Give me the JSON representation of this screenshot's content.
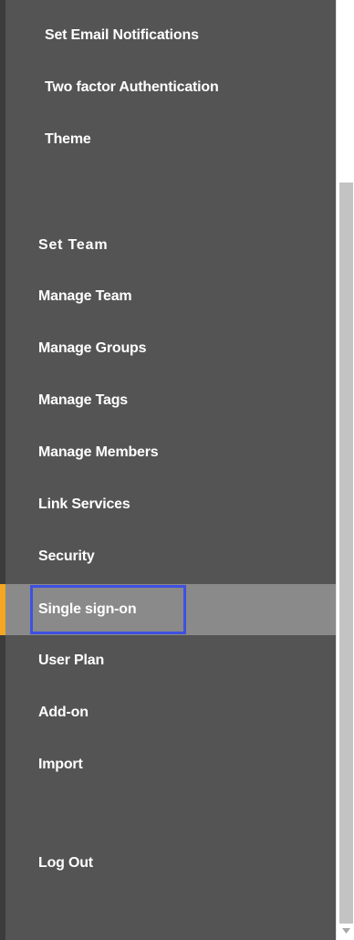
{
  "sidebar": {
    "items_top": [
      {
        "label": "Set Email Notifications"
      },
      {
        "label": "Two factor Authentication"
      },
      {
        "label": "Theme"
      }
    ],
    "section": {
      "label": "Set Team"
    },
    "items_team": [
      {
        "label": "Manage Team"
      },
      {
        "label": "Manage Groups"
      },
      {
        "label": "Manage Tags"
      },
      {
        "label": "Manage Members"
      },
      {
        "label": "Link Services"
      },
      {
        "label": "Security"
      },
      {
        "label": "Single sign-on"
      },
      {
        "label": "User Plan"
      },
      {
        "label": "Add-on"
      },
      {
        "label": "Import"
      }
    ],
    "logout": {
      "label": "Log Out"
    },
    "active_item": "Single sign-on",
    "colors": {
      "background": "#545454",
      "active_background": "#8a8a8a",
      "active_marker": "#f5a623",
      "focus_outline": "#3f51e0",
      "text": "#ffffff"
    }
  },
  "scrollbar": {
    "down_arrow_icon": "chevron-down-icon"
  }
}
